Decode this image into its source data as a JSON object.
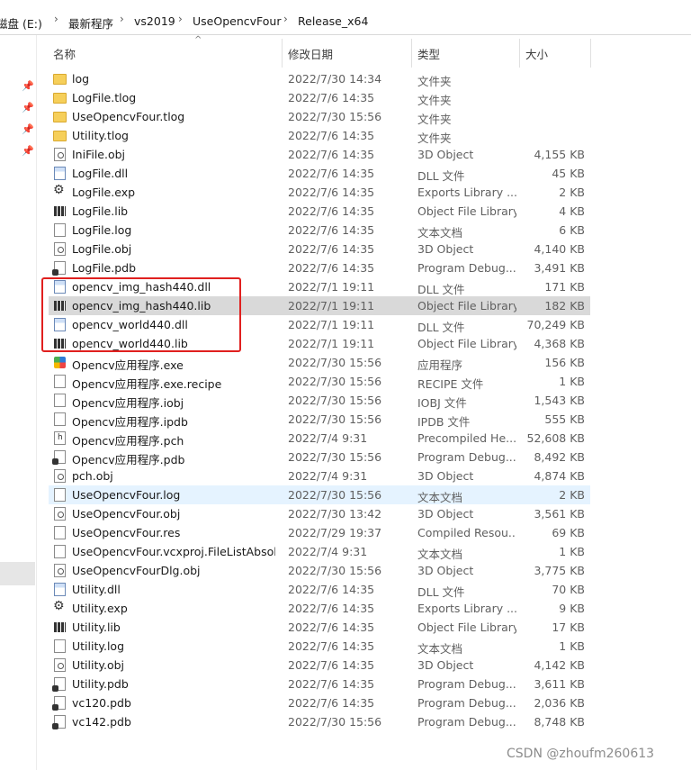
{
  "breadcrumb": [
    "磁盘 (E:)",
    "最新程序",
    "vs2019",
    "UseOpencvFour",
    "Release_x64"
  ],
  "columns": {
    "name": "名称",
    "date": "修改日期",
    "type": "类型",
    "size": "大小"
  },
  "files": [
    {
      "name": "log",
      "date": "2022/7/30 14:34",
      "type": "文件夹",
      "size": "",
      "icon": "folder"
    },
    {
      "name": "LogFile.tlog",
      "date": "2022/7/6 14:35",
      "type": "文件夹",
      "size": "",
      "icon": "folder"
    },
    {
      "name": "UseOpencvFour.tlog",
      "date": "2022/7/30 15:56",
      "type": "文件夹",
      "size": "",
      "icon": "folder"
    },
    {
      "name": "Utility.tlog",
      "date": "2022/7/6 14:35",
      "type": "文件夹",
      "size": "",
      "icon": "folder"
    },
    {
      "name": "IniFile.obj",
      "date": "2022/7/6 14:35",
      "type": "3D Object",
      "size": "4,155 KB",
      "icon": "obj"
    },
    {
      "name": "LogFile.dll",
      "date": "2022/7/6 14:35",
      "type": "DLL 文件",
      "size": "45 KB",
      "icon": "dll"
    },
    {
      "name": "LogFile.exp",
      "date": "2022/7/6 14:35",
      "type": "Exports Library ...",
      "size": "2 KB",
      "icon": "exp"
    },
    {
      "name": "LogFile.lib",
      "date": "2022/7/6 14:35",
      "type": "Object File Library",
      "size": "4 KB",
      "icon": "lib"
    },
    {
      "name": "LogFile.log",
      "date": "2022/7/6 14:35",
      "type": "文本文档",
      "size": "6 KB",
      "icon": "doc"
    },
    {
      "name": "LogFile.obj",
      "date": "2022/7/6 14:35",
      "type": "3D Object",
      "size": "4,140 KB",
      "icon": "obj"
    },
    {
      "name": "LogFile.pdb",
      "date": "2022/7/6 14:35",
      "type": "Program Debug...",
      "size": "3,491 KB",
      "icon": "pdb"
    },
    {
      "name": "opencv_img_hash440.dll",
      "date": "2022/7/1 19:11",
      "type": "DLL 文件",
      "size": "171 KB",
      "icon": "dll"
    },
    {
      "name": "opencv_img_hash440.lib",
      "date": "2022/7/1 19:11",
      "type": "Object File Library",
      "size": "182 KB",
      "icon": "lib",
      "selected": true
    },
    {
      "name": "opencv_world440.dll",
      "date": "2022/7/1 19:11",
      "type": "DLL 文件",
      "size": "70,249 KB",
      "icon": "dll"
    },
    {
      "name": "opencv_world440.lib",
      "date": "2022/7/1 19:11",
      "type": "Object File Library",
      "size": "4,368 KB",
      "icon": "lib"
    },
    {
      "name": "Opencv应用程序.exe",
      "date": "2022/7/30 15:56",
      "type": "应用程序",
      "size": "156 KB",
      "icon": "exe"
    },
    {
      "name": "Opencv应用程序.exe.recipe",
      "date": "2022/7/30 15:56",
      "type": "RECIPE 文件",
      "size": "1 KB",
      "icon": "doc"
    },
    {
      "name": "Opencv应用程序.iobj",
      "date": "2022/7/30 15:56",
      "type": "IOBJ 文件",
      "size": "1,543 KB",
      "icon": "doc"
    },
    {
      "name": "Opencv应用程序.ipdb",
      "date": "2022/7/30 15:56",
      "type": "IPDB 文件",
      "size": "555 KB",
      "icon": "doc"
    },
    {
      "name": "Opencv应用程序.pch",
      "date": "2022/7/4 9:31",
      "type": "Precompiled He...",
      "size": "52,608 KB",
      "icon": "pch"
    },
    {
      "name": "Opencv应用程序.pdb",
      "date": "2022/7/30 15:56",
      "type": "Program Debug...",
      "size": "8,492 KB",
      "icon": "pdb"
    },
    {
      "name": "pch.obj",
      "date": "2022/7/4 9:31",
      "type": "3D Object",
      "size": "4,874 KB",
      "icon": "obj"
    },
    {
      "name": "UseOpencvFour.log",
      "date": "2022/7/30 15:56",
      "type": "文本文档",
      "size": "2 KB",
      "icon": "doc",
      "hover": true
    },
    {
      "name": "UseOpencvFour.obj",
      "date": "2022/7/30 13:42",
      "type": "3D Object",
      "size": "3,561 KB",
      "icon": "obj"
    },
    {
      "name": "UseOpencvFour.res",
      "date": "2022/7/29 19:37",
      "type": "Compiled Resou...",
      "size": "69 KB",
      "icon": "doc"
    },
    {
      "name": "UseOpencvFour.vcxproj.FileListAbsol...",
      "date": "2022/7/4 9:31",
      "type": "文本文档",
      "size": "1 KB",
      "icon": "doc"
    },
    {
      "name": "UseOpencvFourDlg.obj",
      "date": "2022/7/30 15:56",
      "type": "3D Object",
      "size": "3,775 KB",
      "icon": "obj"
    },
    {
      "name": "Utility.dll",
      "date": "2022/7/6 14:35",
      "type": "DLL 文件",
      "size": "70 KB",
      "icon": "dll"
    },
    {
      "name": "Utility.exp",
      "date": "2022/7/6 14:35",
      "type": "Exports Library ...",
      "size": "9 KB",
      "icon": "exp"
    },
    {
      "name": "Utility.lib",
      "date": "2022/7/6 14:35",
      "type": "Object File Library",
      "size": "17 KB",
      "icon": "lib"
    },
    {
      "name": "Utility.log",
      "date": "2022/7/6 14:35",
      "type": "文本文档",
      "size": "1 KB",
      "icon": "doc"
    },
    {
      "name": "Utility.obj",
      "date": "2022/7/6 14:35",
      "type": "3D Object",
      "size": "4,142 KB",
      "icon": "obj"
    },
    {
      "name": "Utility.pdb",
      "date": "2022/7/6 14:35",
      "type": "Program Debug...",
      "size": "3,611 KB",
      "icon": "pdb"
    },
    {
      "name": "vc120.pdb",
      "date": "2022/7/6 14:35",
      "type": "Program Debug...",
      "size": "2,036 KB",
      "icon": "pdb"
    },
    {
      "name": "vc142.pdb",
      "date": "2022/7/30 15:56",
      "type": "Program Debug...",
      "size": "8,748 KB",
      "icon": "pdb"
    }
  ],
  "watermark": "CSDN @zhoufm260613",
  "colors": {
    "highlight_box": "#e0201f",
    "selected_row": "#d9d9d9",
    "hover_row": "#e5f3ff"
  }
}
